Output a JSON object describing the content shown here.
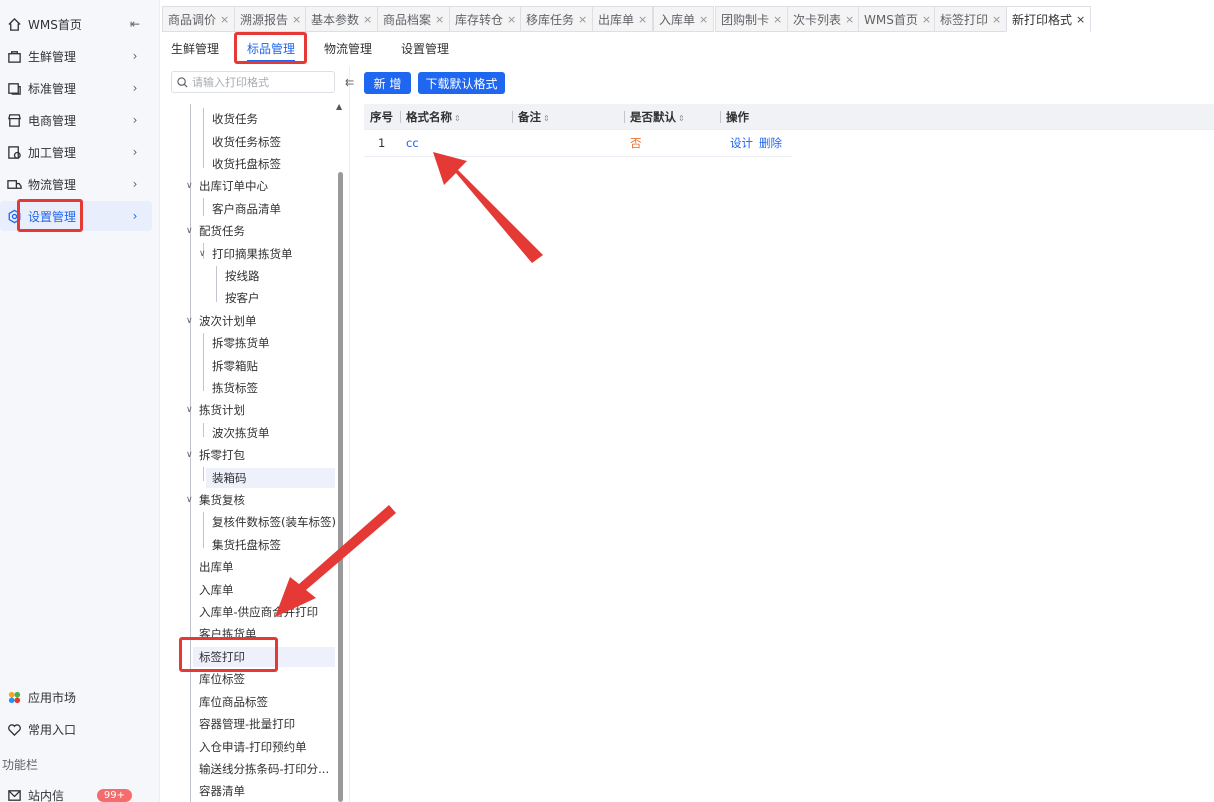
{
  "sidebar": {
    "items": [
      {
        "label": "WMS首页",
        "icon": "home-icon",
        "trailing": "⇤"
      },
      {
        "label": "生鲜管理",
        "icon": "fresh-icon",
        "trailing": "›"
      },
      {
        "label": "标准管理",
        "icon": "standard-icon",
        "trailing": "›"
      },
      {
        "label": "电商管理",
        "icon": "shop-icon",
        "trailing": "›"
      },
      {
        "label": "加工管理",
        "icon": "process-icon",
        "trailing": "›"
      },
      {
        "label": "物流管理",
        "icon": "truck-icon",
        "trailing": "›"
      },
      {
        "label": "设置管理",
        "icon": "settings-icon",
        "trailing": "›"
      }
    ],
    "bottom": [
      {
        "label": "应用市场",
        "icon": "app-market-icon"
      },
      {
        "label": "常用入口",
        "icon": "heart-icon"
      }
    ],
    "section_label": "功能栏",
    "mail": {
      "label": "站内信",
      "badge": "99+"
    }
  },
  "tabs": [
    {
      "label": "商品调价"
    },
    {
      "label": "溯源报告"
    },
    {
      "label": "基本参数"
    },
    {
      "label": "商品档案"
    },
    {
      "label": "库存转仓"
    },
    {
      "label": "移库任务"
    },
    {
      "label": "出库单"
    },
    {
      "label": "入库单"
    },
    {
      "label": "团购制卡"
    },
    {
      "label": "次卡列表"
    },
    {
      "label": "WMS首页"
    },
    {
      "label": "标签打印"
    },
    {
      "label": "新打印格式"
    }
  ],
  "tab_close": "×",
  "subtabs": [
    "生鲜管理",
    "标品管理",
    "物流管理",
    "设置管理"
  ],
  "tree": {
    "search_placeholder": "请输入打印格式",
    "collapse_icon": "⇇",
    "rows": [
      "收货任务",
      "收货任务标签",
      "收货托盘标签",
      "出库订单中心",
      "客户商品清单",
      "配货任务",
      "打印摘果拣货单",
      "按线路",
      "按客户",
      "波次计划单",
      "拆零拣货单",
      "拆零箱贴",
      "拣货标签",
      "拣货计划",
      "波次拣货单",
      "拆零打包",
      "装箱码",
      "集货复核",
      "复核件数标签(装车标签)",
      "集货托盘标签",
      "出库单",
      "入库单",
      "入库单-供应商合并打印",
      "客户拣货单",
      "标签打印",
      "库位标签",
      "库位商品标签",
      "容器管理-批量打印",
      "入仓申请-打印预约单",
      "输送线分拣条码-打印分...",
      "容器清单"
    ],
    "caret_expanded": "∨"
  },
  "toolbar": {
    "add_label": "新 增",
    "download_label": "下载默认格式"
  },
  "table": {
    "columns": [
      "序号",
      "格式名称",
      "备注",
      "是否默认",
      "操作"
    ],
    "sort_icon": "⇕",
    "rows": [
      {
        "index": "1",
        "name": "cc",
        "remark": "",
        "is_default": "否",
        "actions": [
          "设计",
          "删除"
        ]
      }
    ]
  },
  "colors": {
    "accent": "#1f66f0",
    "highlight_box": "#e53935",
    "default_no": "#e6722c"
  }
}
